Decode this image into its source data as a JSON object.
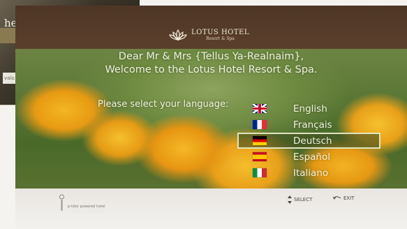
{
  "background": {
    "partial_text": "hers",
    "caption": "valu"
  },
  "header": {
    "logo_name": "LOTUS HOTEL",
    "logo_sub": "Resort & Spa"
  },
  "welcome": {
    "line1": "Dear Mr & Mrs {Tellus Ya-Realnaim},",
    "line2": "Welcome to the Lotus Hotel Resort & Spa."
  },
  "prompt": "Please select your language:",
  "languages": [
    {
      "label": "English",
      "flag": "uk",
      "selected": false
    },
    {
      "label": "Français",
      "flag": "fr",
      "selected": false
    },
    {
      "label": "Deutsch",
      "flag": "de",
      "selected": true
    },
    {
      "label": "Español",
      "flag": "es",
      "selected": false
    },
    {
      "label": "Italiano",
      "flag": "it",
      "selected": false
    }
  ],
  "footer": {
    "brand": "p-Idior powered hotel",
    "select_hint": "SELECT",
    "exit_hint": "EXIT",
    "select_icon": "up-down-arrows-icon",
    "exit_icon": "return-arrow-icon"
  },
  "colors": {
    "header": "#5b3f2c",
    "text": "#eef2dc",
    "highlight_outline": "#dfe5c0"
  }
}
